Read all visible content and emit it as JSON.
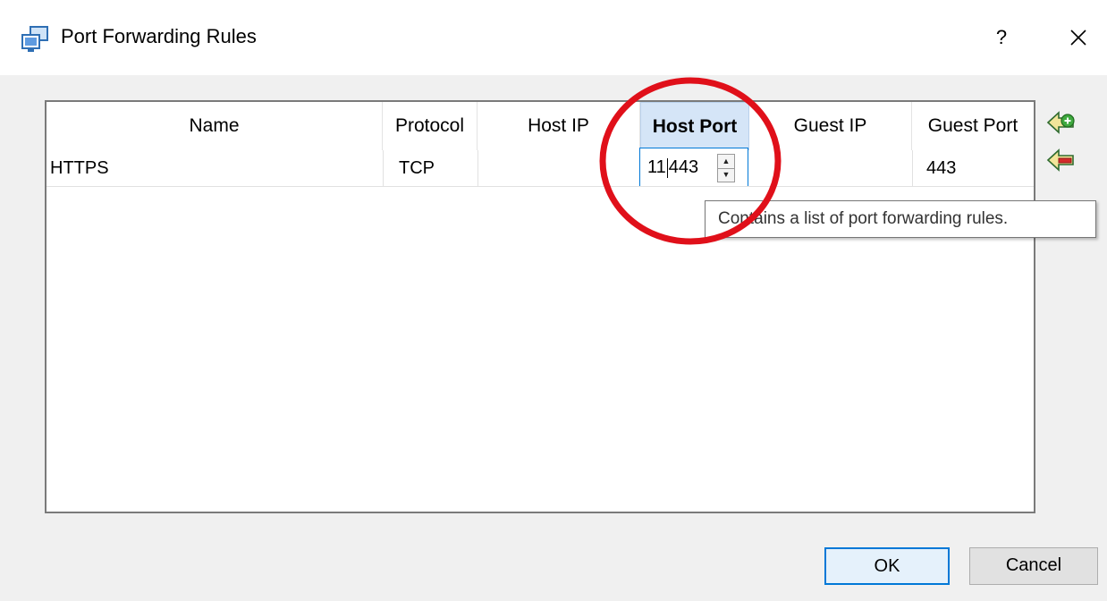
{
  "window": {
    "title": "Port Forwarding Rules",
    "help_label": "?",
    "icon": "port-forwarding-app-icon"
  },
  "table": {
    "columns": [
      "Name",
      "Protocol",
      "Host IP",
      "Host Port",
      "Guest IP",
      "Guest Port"
    ],
    "active_column": "Host Port",
    "rows": [
      {
        "name": "HTTPS",
        "protocol": "TCP",
        "host_ip": "",
        "host_port_before_caret": "11",
        "host_port_after_caret": "443",
        "guest_ip": "",
        "guest_port": "443"
      }
    ]
  },
  "tooltip": {
    "text": "Contains a list of port forwarding rules."
  },
  "side_actions": {
    "add_icon": "add-rule-icon",
    "remove_icon": "remove-rule-icon"
  },
  "buttons": {
    "ok": "OK",
    "cancel": "Cancel"
  },
  "colors": {
    "active_header": "#d5e5f7",
    "annotation_circle": "#e0101a",
    "focus_border": "#0078d7"
  }
}
